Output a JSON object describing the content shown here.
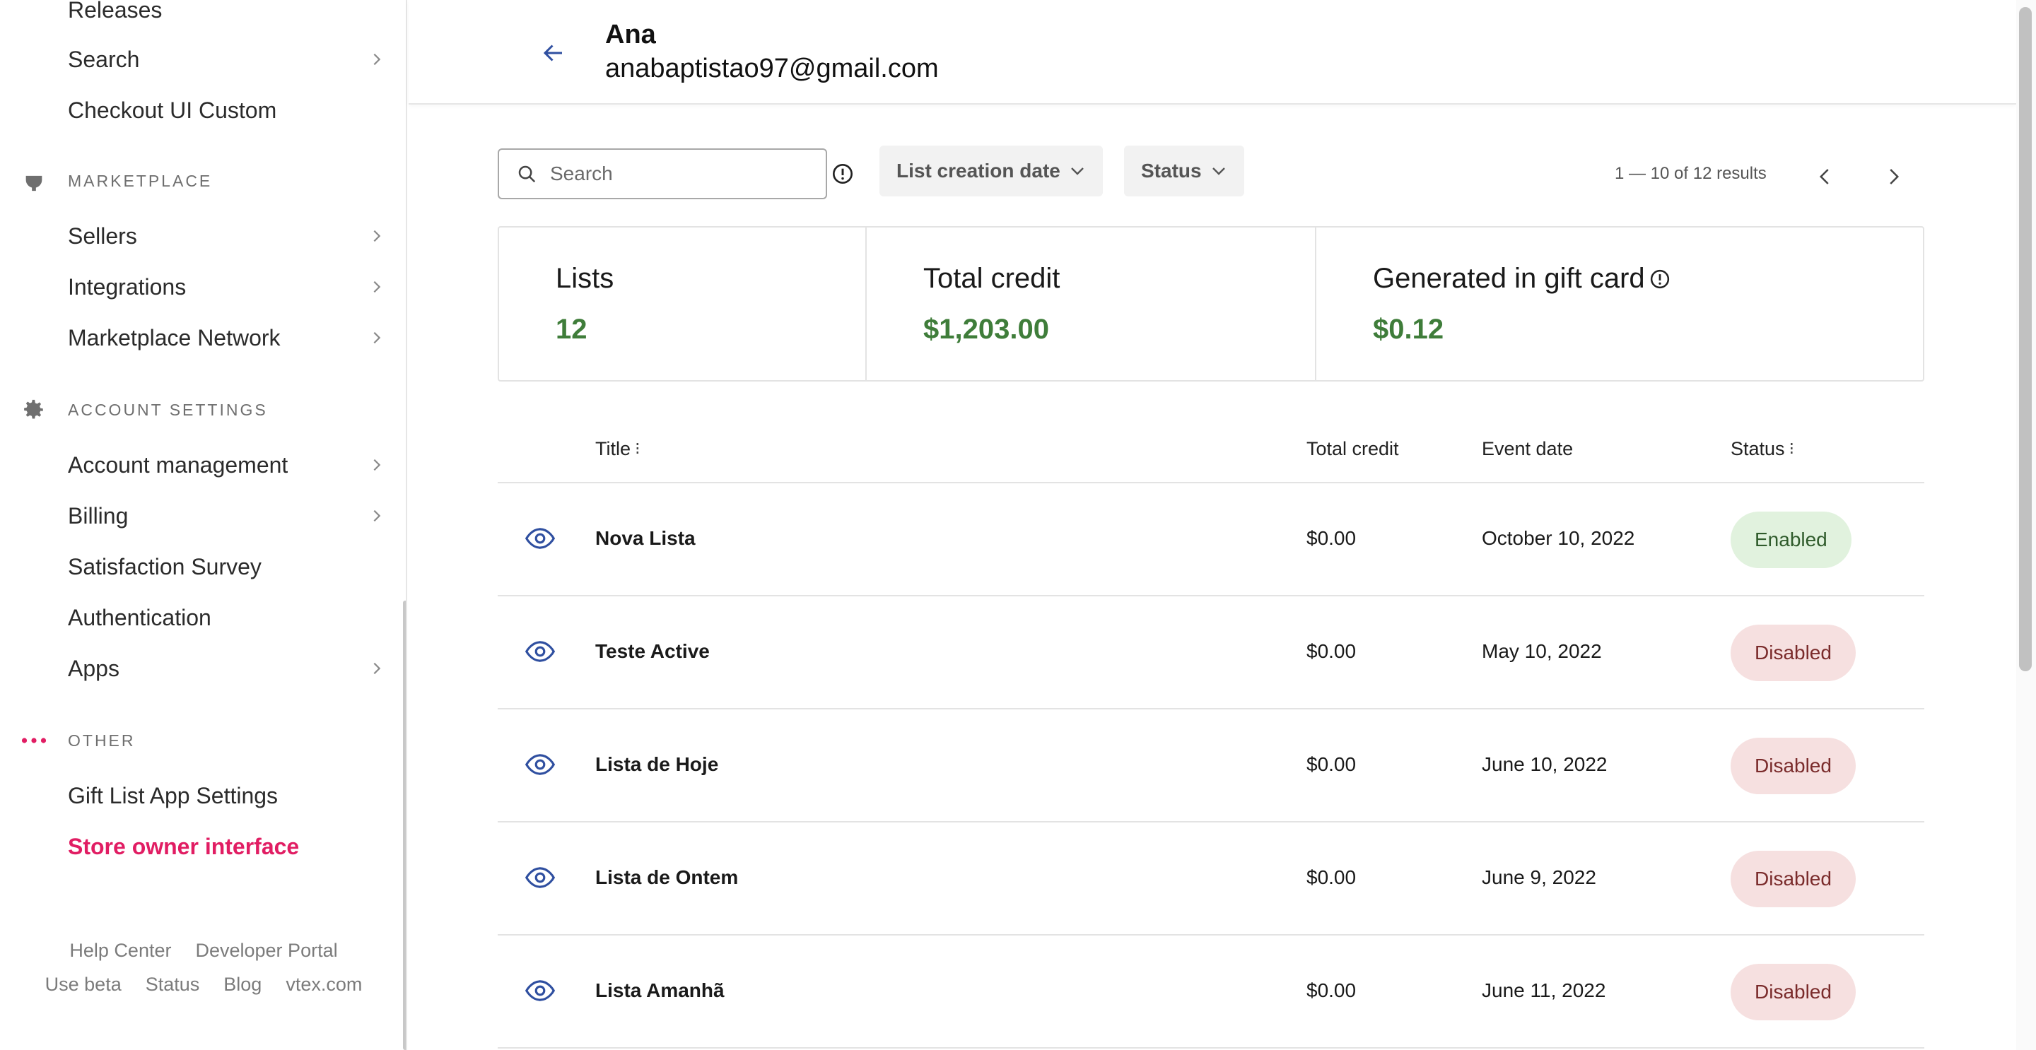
{
  "sidebar": {
    "top_items": [
      {
        "label": "Releases",
        "has_chevron": false
      },
      {
        "label": "Search",
        "has_chevron": true
      },
      {
        "label": "Checkout UI Custom",
        "has_chevron": false
      }
    ],
    "sections": [
      {
        "title": "MARKETPLACE",
        "icon": "plug-icon",
        "items": [
          {
            "label": "Sellers",
            "has_chevron": true
          },
          {
            "label": "Integrations",
            "has_chevron": true
          },
          {
            "label": "Marketplace Network",
            "has_chevron": true
          }
        ]
      },
      {
        "title": "ACCOUNT SETTINGS",
        "icon": "gear-icon",
        "items": [
          {
            "label": "Account management",
            "has_chevron": true
          },
          {
            "label": "Billing",
            "has_chevron": true
          },
          {
            "label": "Satisfaction Survey",
            "has_chevron": false
          },
          {
            "label": "Authentication",
            "has_chevron": false
          },
          {
            "label": "Apps",
            "has_chevron": true
          }
        ]
      },
      {
        "title": "OTHER",
        "icon": "more-dots-icon",
        "items": [
          {
            "label": "Gift List App Settings",
            "has_chevron": false
          },
          {
            "label": "Store owner interface",
            "has_chevron": false,
            "active": true
          }
        ]
      }
    ],
    "footer_row1": [
      "Help Center",
      "Developer Portal"
    ],
    "footer_row2": [
      "Use beta",
      "Status",
      "Blog",
      "vtex.com"
    ]
  },
  "header": {
    "name": "Ana",
    "email": "anabaptistao97@gmail.com"
  },
  "toolbar": {
    "search_placeholder": "Search",
    "filter_date": "List creation date",
    "filter_status": "Status",
    "results": "1 — 10 of 12 results"
  },
  "stats": [
    {
      "label": "Lists",
      "value": "12"
    },
    {
      "label": "Total credit",
      "value": "$1,203.00"
    },
    {
      "label": "Generated in gift card",
      "value": "$0.12",
      "info": true
    }
  ],
  "table": {
    "columns": {
      "title": "Title",
      "total_credit": "Total credit",
      "event_date": "Event date",
      "status": "Status"
    },
    "rows": [
      {
        "title": "Nova Lista",
        "credit": "$0.00",
        "date": "October 10, 2022",
        "status": "Enabled"
      },
      {
        "title": "Teste Active",
        "credit": "$0.00",
        "date": "May 10, 2022",
        "status": "Disabled"
      },
      {
        "title": "Lista de Hoje",
        "credit": "$0.00",
        "date": "June 10, 2022",
        "status": "Disabled"
      },
      {
        "title": "Lista de Ontem",
        "credit": "$0.00",
        "date": "June 9, 2022",
        "status": "Disabled"
      },
      {
        "title": "Lista Amanhã",
        "credit": "$0.00",
        "date": "June 11, 2022",
        "status": "Disabled"
      }
    ]
  },
  "colors": {
    "accent_pink": "#e11d63",
    "value_green": "#3f7d3a",
    "link_blue": "#2f4fa0"
  }
}
